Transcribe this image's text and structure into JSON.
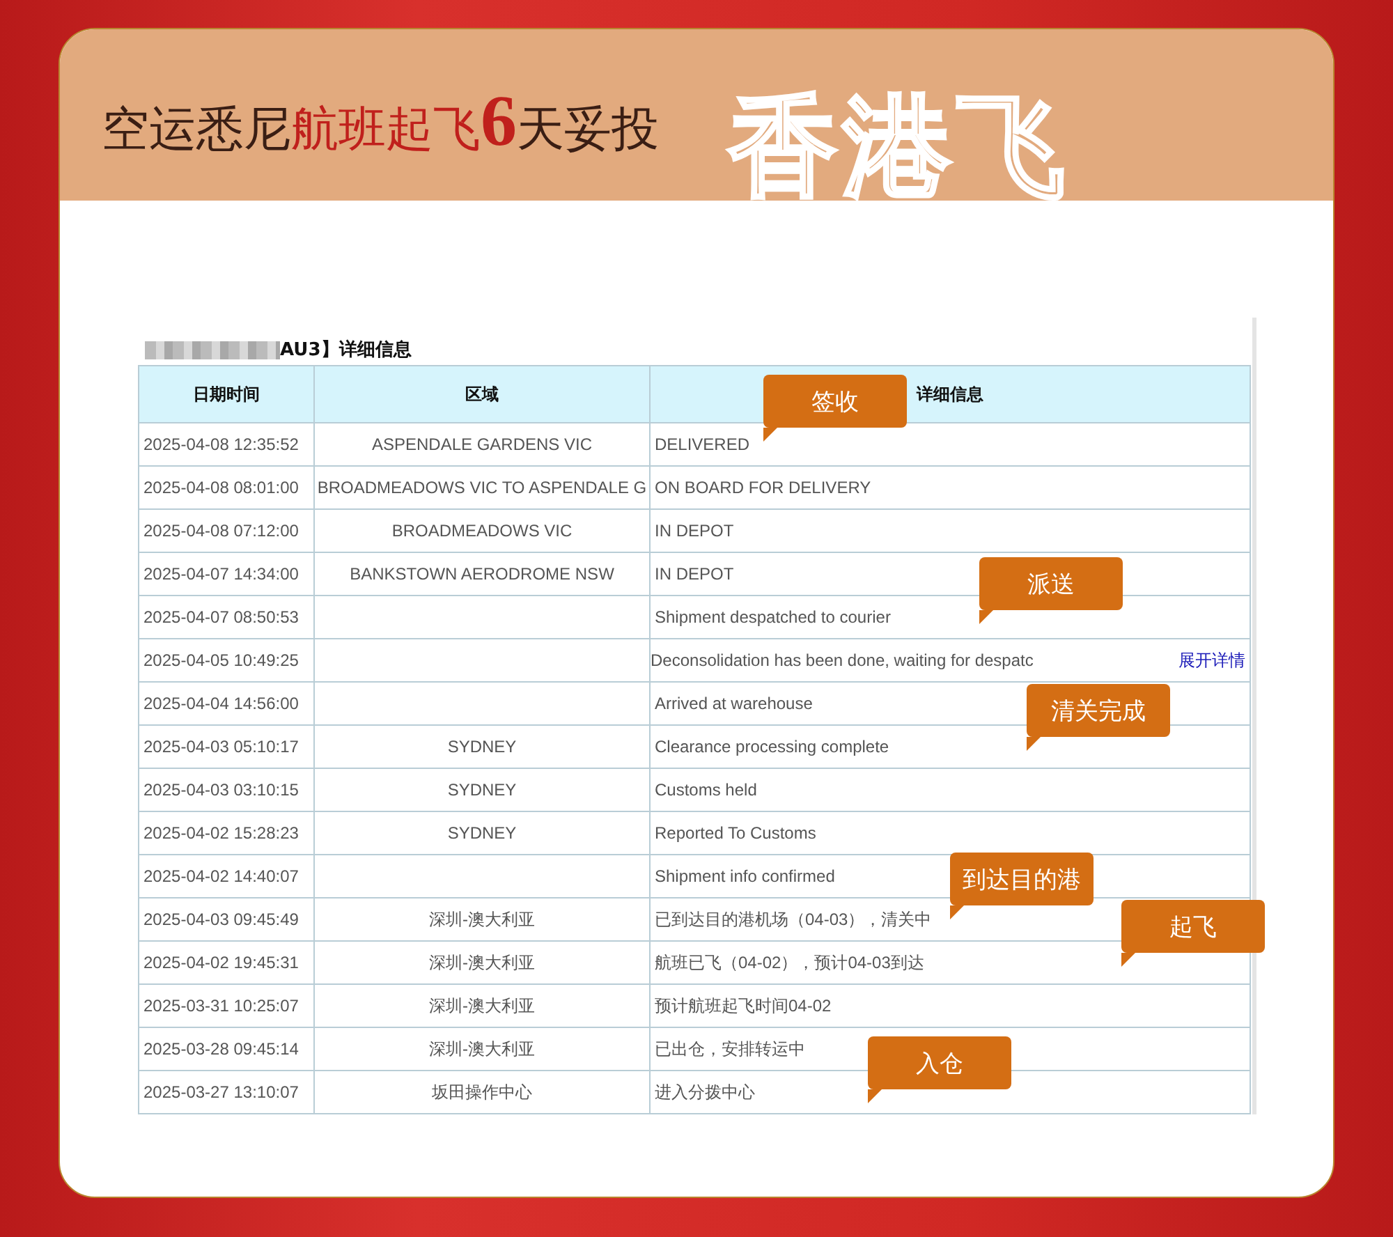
{
  "banner": {
    "title_parts": [
      {
        "text": "空运悉尼",
        "kind": "plain"
      },
      {
        "text": "航班起飞",
        "kind": "accent"
      },
      {
        "text": "6",
        "kind": "number"
      },
      {
        "text": "天妥投",
        "kind": "plain"
      }
    ],
    "outline_title": "香港飞"
  },
  "tracking": {
    "title": "AU3】详细信息",
    "columns": [
      "日期时间",
      "区域",
      "详细信息"
    ],
    "rows": [
      {
        "date": "2025-04-08 12:35:52",
        "region": "ASPENDALE GARDENS VIC",
        "detail": "DELIVERED"
      },
      {
        "date": "2025-04-08 08:01:00",
        "region": "BROADMEADOWS VIC TO ASPENDALE G",
        "detail": "ON BOARD FOR DELIVERY"
      },
      {
        "date": "2025-04-08 07:12:00",
        "region": "BROADMEADOWS VIC",
        "detail": "IN DEPOT"
      },
      {
        "date": "2025-04-07 14:34:00",
        "region": "BANKSTOWN AERODROME NSW",
        "detail": "IN DEPOT"
      },
      {
        "date": "2025-04-07 08:50:53",
        "region": "",
        "detail": "Shipment despatched to courier"
      },
      {
        "date": "2025-04-05 10:49:25",
        "region": "",
        "detail": "Deconsolidation has been done, waiting for despatc",
        "link": "展开详情"
      },
      {
        "date": "2025-04-04 14:56:00",
        "region": "",
        "detail": "Arrived at warehouse"
      },
      {
        "date": "2025-04-03 05:10:17",
        "region": "SYDNEY",
        "detail": "Clearance processing complete"
      },
      {
        "date": "2025-04-03 03:10:15",
        "region": "SYDNEY",
        "detail": "Customs held"
      },
      {
        "date": "2025-04-02 15:28:23",
        "region": "SYDNEY",
        "detail": "Reported To Customs"
      },
      {
        "date": "2025-04-02 14:40:07",
        "region": "",
        "detail": "Shipment info confirmed"
      },
      {
        "date": "2025-04-03 09:45:49",
        "region": "深圳-澳大利亚",
        "detail": "已到达目的港机场（04-03），清关中"
      },
      {
        "date": "2025-04-02 19:45:31",
        "region": "深圳-澳大利亚",
        "detail": "航班已飞（04-02），预计04-03到达"
      },
      {
        "date": "2025-03-31 10:25:07",
        "region": "深圳-澳大利亚",
        "detail": "预计航班起飞时间04-02"
      },
      {
        "date": "2025-03-28 09:45:14",
        "region": "深圳-澳大利亚",
        "detail": "已出仓，安排转运中"
      },
      {
        "date": "2025-03-27 13:10:07",
        "region": "坂田操作中心",
        "detail": "进入分拨中心"
      }
    ]
  },
  "callouts": [
    "签收",
    "派送",
    "清关完成",
    "到达目的港",
    "起飞",
    "入仓"
  ]
}
